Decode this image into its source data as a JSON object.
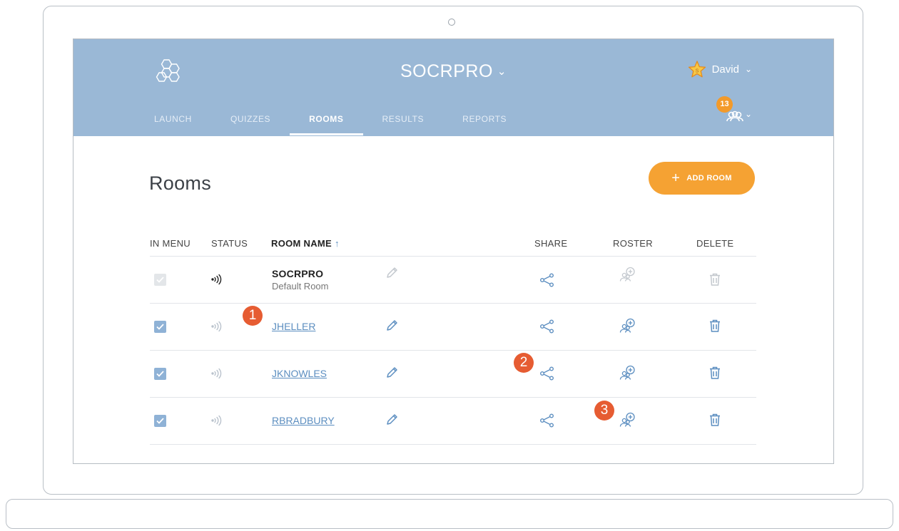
{
  "header": {
    "app_title": "SOCRPRO",
    "user_name": "David",
    "notification_count": "13",
    "tabs": [
      {
        "label": "LAUNCH",
        "active": false
      },
      {
        "label": "QUIZZES",
        "active": false
      },
      {
        "label": "ROOMS",
        "active": true
      },
      {
        "label": "RESULTS",
        "active": false
      },
      {
        "label": "REPORTS",
        "active": false
      }
    ]
  },
  "page": {
    "title": "Rooms",
    "add_room_label": "ADD ROOM"
  },
  "table": {
    "columns": {
      "in_menu": "IN MENU",
      "status": "STATUS",
      "room_name": "ROOM NAME",
      "room_name_sort": "↑",
      "share": "SHARE",
      "roster": "ROSTER",
      "delete": "DELETE"
    },
    "rows": [
      {
        "name": "SOCRPRO",
        "subtitle": "Default Room",
        "in_menu": true,
        "default": true
      },
      {
        "name": "JHELLER",
        "subtitle": "",
        "in_menu": true,
        "default": false
      },
      {
        "name": "JKNOWLES",
        "subtitle": "",
        "in_menu": true,
        "default": false
      },
      {
        "name": "RBRADBURY",
        "subtitle": "",
        "in_menu": true,
        "default": false
      }
    ]
  },
  "callouts": [
    "1",
    "2",
    "3"
  ],
  "colors": {
    "header_bg": "#9ab8d6",
    "accent": "#f5a233",
    "badge": "#f39a2a",
    "callout": "#e65c32",
    "icon_blue": "#5c8ec0",
    "icon_disabled": "#c3c8ce"
  }
}
